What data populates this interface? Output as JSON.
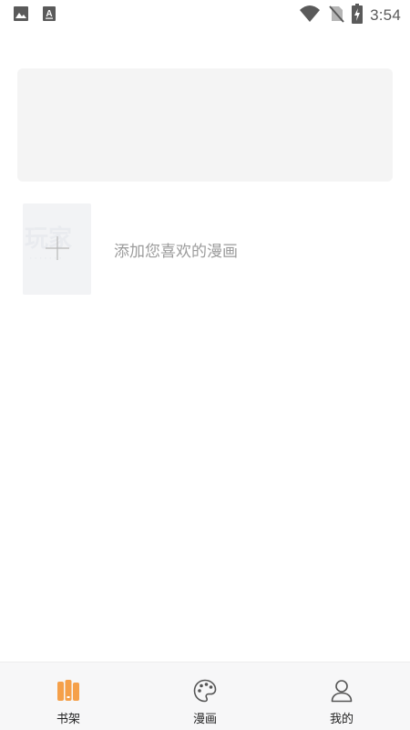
{
  "status_bar": {
    "time": "3:54",
    "left_icons": [
      "image-icon",
      "text-a-icon"
    ],
    "right_icons": [
      "wifi-icon",
      "no-sim-icon",
      "battery-charging-icon"
    ]
  },
  "shelf": {
    "add_text": "添加您喜欢的漫画",
    "thumb_icon": "plus-icon"
  },
  "nav": {
    "items": [
      {
        "label": "书架",
        "icon": "bookshelf-icon",
        "active": true
      },
      {
        "label": "漫画",
        "icon": "palette-icon",
        "active": false
      },
      {
        "label": "我的",
        "icon": "user-icon",
        "active": false
      }
    ]
  },
  "colors": {
    "accent": "#f5a04a",
    "icon_gray": "#555555",
    "banner_bg": "#f4f4f4",
    "nav_bg": "#f7f7f8"
  }
}
